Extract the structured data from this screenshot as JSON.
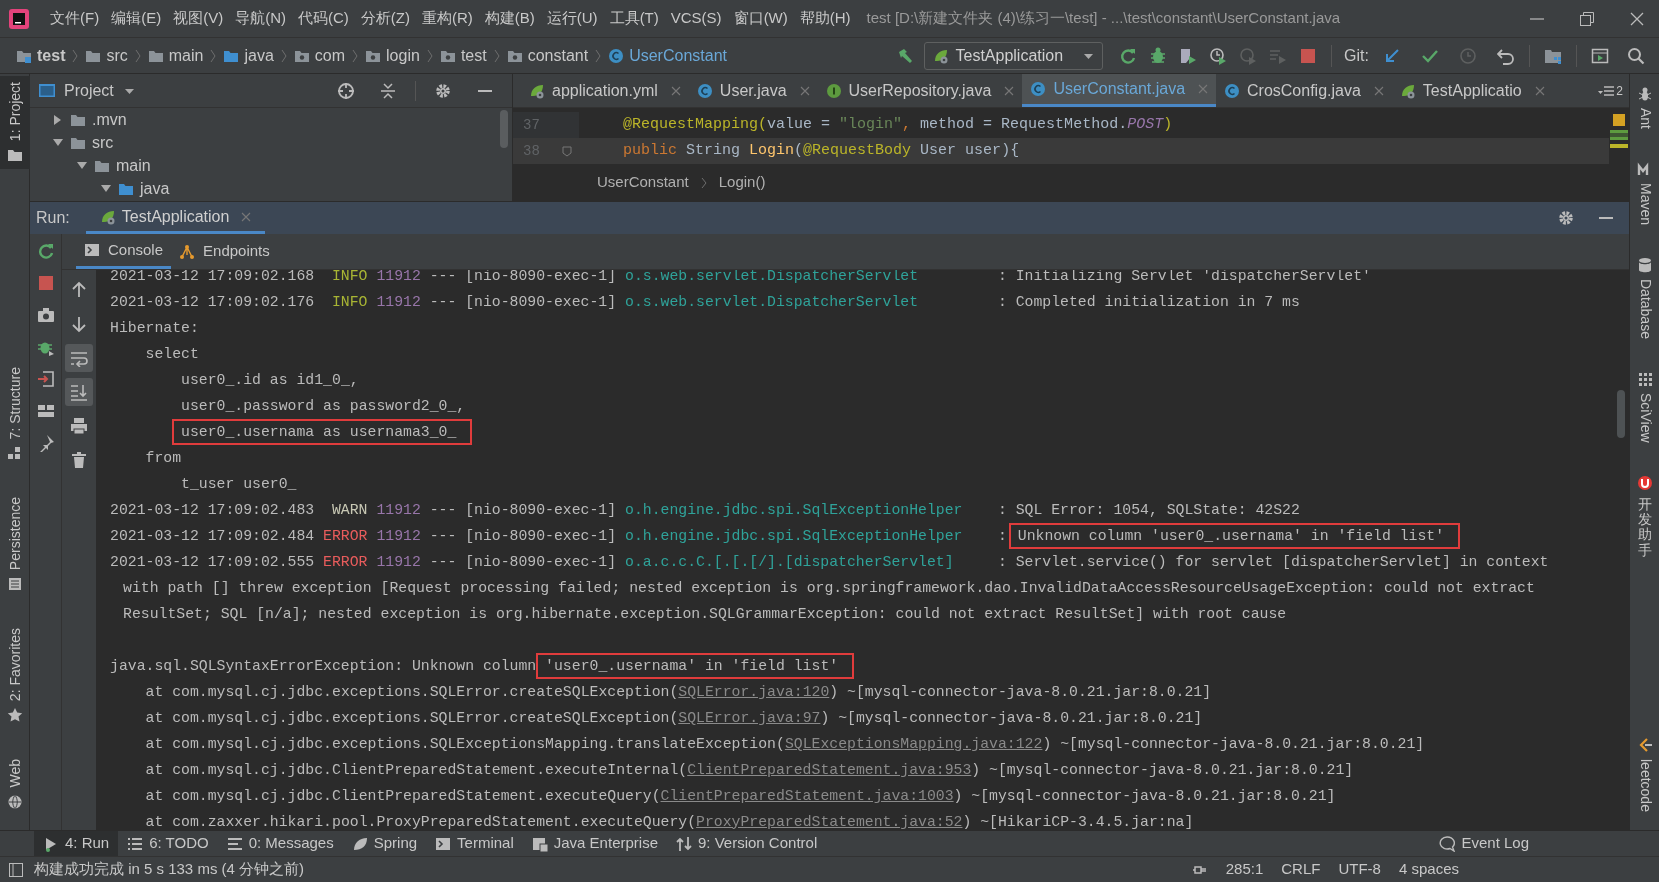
{
  "menu_bar": {
    "items": [
      "文件(F)",
      "编辑(E)",
      "视图(V)",
      "导航(N)",
      "代码(C)",
      "分析(Z)",
      "重构(R)",
      "构建(B)",
      "运行(U)",
      "工具(T)",
      "VCS(S)",
      "窗口(W)",
      "帮助(H)"
    ],
    "title": "test [D:\\新建文件夹 (4)\\练习一\\test] - ...\\test\\constant\\UserConstant.java"
  },
  "nav_bar": {
    "breadcrumbs": [
      {
        "label": "test",
        "kind": "project"
      },
      {
        "label": "src",
        "kind": "folder"
      },
      {
        "label": "main",
        "kind": "folder"
      },
      {
        "label": "java",
        "kind": "source"
      },
      {
        "label": "com",
        "kind": "package"
      },
      {
        "label": "login",
        "kind": "package"
      },
      {
        "label": "test",
        "kind": "package"
      },
      {
        "label": "constant",
        "kind": "package"
      },
      {
        "label": "UserConstant",
        "kind": "class"
      }
    ],
    "run_config": "TestApplication",
    "git_label": "Git:"
  },
  "left_stripe": [
    {
      "label": "1: Project",
      "kind": "project",
      "selected": true
    },
    {
      "label": "7: Structure",
      "kind": "structure",
      "selected": false
    },
    {
      "label": "Persistence",
      "kind": "persistence",
      "selected": false
    },
    {
      "label": "2: Favorites",
      "kind": "favorites",
      "selected": false
    },
    {
      "label": "Web",
      "kind": "web",
      "selected": false
    }
  ],
  "right_stripe": [
    {
      "label": "Ant",
      "kind": "ant"
    },
    {
      "label": "Maven",
      "kind": "maven"
    },
    {
      "label": "Database",
      "kind": "database"
    },
    {
      "label": "SciView",
      "kind": "sciview"
    },
    {
      "label": "开发助手",
      "kind": "helper"
    },
    {
      "label": "leetcode",
      "kind": "leetcode"
    }
  ],
  "project_panel": {
    "title": "Project",
    "tree": [
      {
        "label": ".mvn",
        "expanded": false
      },
      {
        "label": "src",
        "expanded": true,
        "children": [
          {
            "label": "main",
            "expanded": true,
            "children": [
              {
                "label": "java",
                "expanded": true,
                "kind": "source"
              }
            ]
          }
        ]
      }
    ]
  },
  "editor": {
    "tabs": [
      {
        "label": "application.yml",
        "kind": "yml",
        "selected": false
      },
      {
        "label": "User.java",
        "kind": "class",
        "selected": false
      },
      {
        "label": "UserRepository.java",
        "kind": "interface",
        "selected": false
      },
      {
        "label": "UserConstant.java",
        "kind": "class",
        "selected": true
      },
      {
        "label": "CrosConfig.java",
        "kind": "class",
        "selected": false
      },
      {
        "label": "TestApplicatio",
        "kind": "spring",
        "selected": false
      }
    ],
    "tab_count": "2",
    "lines": [
      {
        "number": "37",
        "current": false,
        "parts": [
          {
            "text": "    @RequestMapping(",
            "kind": "annotation"
          },
          {
            "text": "value",
            "kind": "plain"
          },
          {
            "text": " = ",
            "kind": "plain"
          },
          {
            "text": "\"login\"",
            "kind": "string"
          },
          {
            "text": ", ",
            "kind": "keyword"
          },
          {
            "text": "method",
            "kind": "plain"
          },
          {
            "text": " = RequestMethod.",
            "kind": "plain"
          },
          {
            "text": "POST",
            "kind": "constant"
          },
          {
            "text": ")",
            "kind": "annotation"
          }
        ]
      },
      {
        "number": "38",
        "current": true,
        "parts": [
          {
            "text": "    public ",
            "kind": "keyword"
          },
          {
            "text": "String ",
            "kind": "plain"
          },
          {
            "text": "Login",
            "kind": "function"
          },
          {
            "text": "(",
            "kind": "plain"
          },
          {
            "text": "@RequestBody",
            "kind": "annotation"
          },
          {
            "text": " User user",
            "kind": "plain"
          },
          {
            "text": "){",
            "kind": "plain"
          }
        ]
      }
    ],
    "breadcrumb": [
      "UserConstant",
      "Login()"
    ]
  },
  "run": {
    "label": "Run:",
    "tabs": [
      {
        "label": "TestApplication",
        "selected": true
      }
    ],
    "subtabs": [
      {
        "label": "Console",
        "kind": "console",
        "selected": true
      },
      {
        "label": "Endpoints",
        "kind": "endpoints",
        "selected": false
      }
    ],
    "console_toolbar": [
      {
        "kind": "up",
        "on": false
      },
      {
        "kind": "down",
        "on": false
      },
      {
        "kind": "wrap",
        "on": true
      },
      {
        "kind": "scroll",
        "on": true
      },
      {
        "kind": "print",
        "on": false
      },
      {
        "kind": "trash",
        "on": false
      }
    ],
    "console": [
      {
        "kind": "log",
        "timestamp": "2021-03-12 17:09:02.168",
        "level": {
          "text": "INFO",
          "color": "#a8b534"
        },
        "pid": "11912",
        "separator": "---",
        "thread": "[nio-8090-exec-1]",
        "logger": "o.s.web.servlet.DispatcherServlet",
        "delimiter": ":",
        "message": "Initializing Servlet 'dispatcherServlet'",
        "boxed": false
      },
      {
        "kind": "log",
        "timestamp": "2021-03-12 17:09:02.176",
        "level": {
          "text": "INFO",
          "color": "#a8b534"
        },
        "pid": "11912",
        "separator": "---",
        "thread": "[nio-8090-exec-1]",
        "logger": "o.s.web.servlet.DispatcherServlet",
        "delimiter": ":",
        "message": "Completed initialization in 7 ms",
        "boxed": false
      },
      {
        "kind": "text",
        "parts": [
          {
            "text": "Hibernate:",
            "kind": "plain"
          }
        ]
      },
      {
        "kind": "text",
        "parts": [
          {
            "text": "    select",
            "kind": "plain"
          }
        ]
      },
      {
        "kind": "text",
        "parts": [
          {
            "text": "        user0_.id as id1_0_,",
            "kind": "plain"
          }
        ]
      },
      {
        "kind": "text",
        "parts": [
          {
            "text": "        user0_.password as password2_0_,",
            "kind": "plain"
          }
        ]
      },
      {
        "kind": "text",
        "parts": [
          {
            "text": "        user0_.usernama as usernama3_0_",
            "kind": "boxed"
          }
        ]
      },
      {
        "kind": "text",
        "parts": [
          {
            "text": "    from",
            "kind": "plain"
          }
        ]
      },
      {
        "kind": "text",
        "parts": [
          {
            "text": "        t_user user0_",
            "kind": "plain"
          }
        ]
      },
      {
        "kind": "log",
        "timestamp": "2021-03-12 17:09:02.483",
        "level": {
          "text": "WARN",
          "color": "#c8c8b4"
        },
        "pid": "11912",
        "separator": "---",
        "thread": "[nio-8090-exec-1]",
        "logger": "o.h.engine.jdbc.spi.SqlExceptionHelper",
        "delimiter": ":",
        "message": "SQL Error: 1054, SQLState: 42S22",
        "boxed": false
      },
      {
        "kind": "log",
        "timestamp": "2021-03-12 17:09:02.484",
        "level": {
          "text": "ERROR",
          "color": "#e85c5c"
        },
        "pid": "11912",
        "separator": "---",
        "thread": "[nio-8090-exec-1]",
        "logger": "o.h.engine.jdbc.spi.SqlExceptionHelper",
        "delimiter": ":",
        "message": "Unknown column 'user0_.usernama' in 'field list'",
        "boxed": true
      },
      {
        "kind": "log",
        "timestamp": "2021-03-12 17:09:02.555",
        "level": {
          "text": "ERROR",
          "color": "#e85c5c"
        },
        "pid": "11912",
        "separator": "---",
        "thread": "[nio-8090-exec-1]",
        "logger": "o.a.c.c.C.[.[.[/].[dispatcherServlet]",
        "delimiter": ":",
        "message": "Servlet.service() for servlet [dispatcherServlet] in context",
        "boxed": false
      },
      {
        "kind": "wrap",
        "parts": [
          {
            "text": "with path [] threw exception [Request processing failed; nested exception is org.springframework.dao.InvalidDataAccessResourceUsageException: could not extract",
            "kind": "plain"
          }
        ]
      },
      {
        "kind": "wrap",
        "parts": [
          {
            "text": "ResultSet; SQL [n/a]; nested exception is org.hibernate.exception.SQLGrammarException: could not extract ResultSet] with root cause",
            "kind": "plain"
          }
        ]
      },
      {
        "kind": "blank"
      },
      {
        "kind": "text",
        "parts": [
          {
            "text": "java.sql.SQLSyntaxErrorException: Unknown column ",
            "kind": "plain"
          },
          {
            "text": "'user0_.usernama' in 'field list'",
            "kind": "boxed"
          }
        ]
      },
      {
        "kind": "text",
        "parts": [
          {
            "text": "    at com.mysql.cj.jdbc.exceptions.SQLError.createSQLException(",
            "kind": "plain"
          },
          {
            "text": "SQLError.java:120",
            "kind": "link"
          },
          {
            "text": ") ~[mysql-connector-java-8.0.21.jar:8.0.21]",
            "kind": "plain"
          }
        ]
      },
      {
        "kind": "text",
        "parts": [
          {
            "text": "    at com.mysql.cj.jdbc.exceptions.SQLError.createSQLException(",
            "kind": "plain"
          },
          {
            "text": "SQLError.java:97",
            "kind": "link"
          },
          {
            "text": ") ~[mysql-connector-java-8.0.21.jar:8.0.21]",
            "kind": "plain"
          }
        ]
      },
      {
        "kind": "text",
        "parts": [
          {
            "text": "    at com.mysql.cj.jdbc.exceptions.SQLExceptionsMapping.translateException(",
            "kind": "plain"
          },
          {
            "text": "SQLExceptionsMapping.java:122",
            "kind": "link"
          },
          {
            "text": ") ~[mysql-connector-java-8.0.21.jar:8.0.21]",
            "kind": "plain"
          }
        ]
      },
      {
        "kind": "text",
        "parts": [
          {
            "text": "    at com.mysql.cj.jdbc.ClientPreparedStatement.executeInternal(",
            "kind": "plain"
          },
          {
            "text": "ClientPreparedStatement.java:953",
            "kind": "link"
          },
          {
            "text": ") ~[mysql-connector-java-8.0.21.jar:8.0.21]",
            "kind": "plain"
          }
        ]
      },
      {
        "kind": "text",
        "parts": [
          {
            "text": "    at com.mysql.cj.jdbc.ClientPreparedStatement.executeQuery(",
            "kind": "plain"
          },
          {
            "text": "ClientPreparedStatement.java:1003",
            "kind": "link"
          },
          {
            "text": ") ~[mysql-connector-java-8.0.21.jar:8.0.21]",
            "kind": "plain"
          }
        ]
      },
      {
        "kind": "text",
        "parts": [
          {
            "text": "    at com.zaxxer.hikari.pool.ProxyPreparedStatement.executeQuery(",
            "kind": "plain"
          },
          {
            "text": "ProxyPreparedStatement.java:52",
            "kind": "link"
          },
          {
            "text": ") ~[HikariCP-3.4.5.jar:na]",
            "kind": "plain"
          }
        ]
      }
    ]
  },
  "tool_windows": [
    {
      "label": "4: Run",
      "kind": "run",
      "selected": true
    },
    {
      "label": "6: TODO",
      "kind": "todo",
      "selected": false
    },
    {
      "label": "0: Messages",
      "kind": "messages",
      "selected": false
    },
    {
      "label": "Spring",
      "kind": "spring",
      "selected": false
    },
    {
      "label": "Terminal",
      "kind": "terminal",
      "selected": false
    },
    {
      "label": "Java Enterprise",
      "kind": "enterprise",
      "selected": false
    },
    {
      "label": "9: Version Control",
      "kind": "vcs",
      "selected": false
    }
  ],
  "event_log": "Event Log",
  "status_bar": {
    "message": "构建成功完成 in 5 s 133 ms (4 分钟之前)",
    "items": [
      "285:1",
      "CRLF",
      "UTF-8",
      "4 spaces"
    ]
  }
}
